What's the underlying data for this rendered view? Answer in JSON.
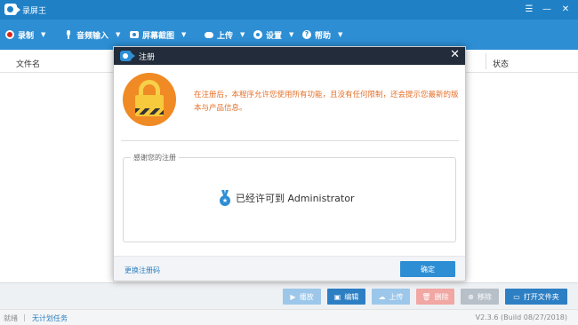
{
  "window": {
    "title": "录屏王",
    "buttons": {
      "menu": "☰",
      "minimize": "—",
      "close": "✕"
    }
  },
  "toolbar": {
    "items": [
      {
        "label": "录制",
        "icon": "record-icon"
      },
      {
        "label": "音频输入",
        "icon": "microphone-icon"
      },
      {
        "label": "屏幕截图",
        "icon": "camera-icon"
      },
      {
        "label": "上传",
        "icon": "cloud-upload-icon"
      },
      {
        "label": "设置",
        "icon": "gear-icon"
      },
      {
        "label": "帮助",
        "icon": "help-icon"
      }
    ]
  },
  "file_list": {
    "columns": {
      "name": "文件名",
      "status": "状态"
    }
  },
  "actions": {
    "play": "播放",
    "edit": "编辑",
    "upload": "上传",
    "delete": "删除",
    "remove": "移除",
    "open_folder": "打开文件夹"
  },
  "statusbar": {
    "ready": "就绪",
    "separator": "|",
    "no_plan": "无计划任务",
    "version": "V2.3.6 (Build 08/27/2018)"
  },
  "dialog": {
    "title": "注册",
    "close": "✕",
    "message": "在注册后，本程序允许您使用所有功能，且没有任何限制，还会提示您最新的版本与产品信息。",
    "group_legend": "感谢您的注册",
    "licensed_text": "已经许可到 Administrator",
    "change_code": "更换注册码",
    "ok": "确定"
  },
  "colors": {
    "titlebar": "#1f80c6",
    "toolbar": "#2d8ed4",
    "dialog_title": "#222c3a",
    "message": "#e4702a",
    "lock_bg": "#f08a24"
  }
}
